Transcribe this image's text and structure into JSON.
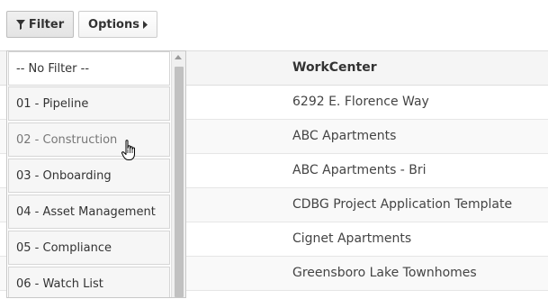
{
  "toolbar": {
    "filter_label": "Filter",
    "filter_icon": "funnel-icon",
    "options_label": "Options",
    "options_icon": "caret-right-icon"
  },
  "grid": {
    "column_header": "WorkCenter",
    "rows": [
      "6292 E. Florence Way",
      "ABC Apartments",
      "ABC Apartments - Bri",
      "CDBG Project Application Template",
      "Cignet Apartments",
      "Greensboro Lake Townhomes"
    ]
  },
  "filter_dropdown": {
    "items": [
      "-- No Filter --",
      "01 - Pipeline",
      "02 - Construction",
      "03 - Onboarding",
      "04 - Asset Management",
      "05 - Compliance",
      "06 - Watch List"
    ],
    "hovered_index": 2
  },
  "colors": {
    "border": "#cccccc",
    "header_bg": "#f5f5f5",
    "item_bg": "#f6f6f6"
  }
}
